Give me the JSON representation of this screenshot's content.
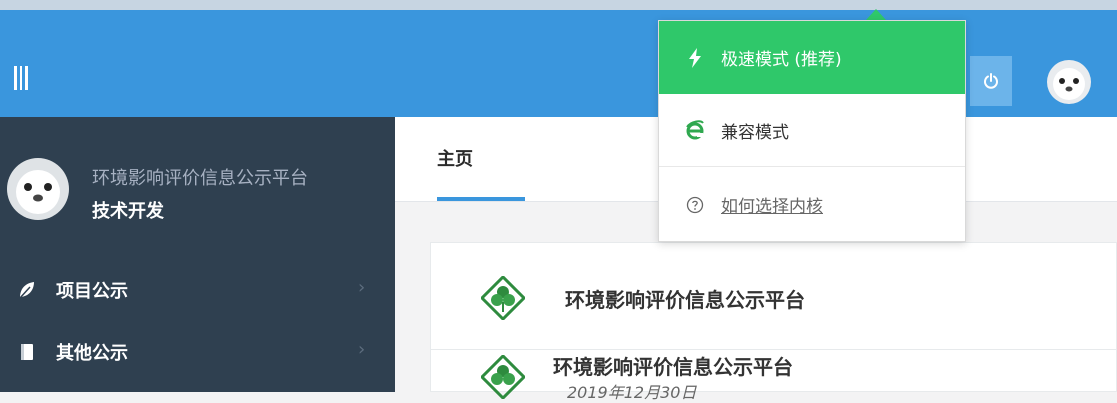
{
  "header": {
    "menu_icon": "menu-bars-icon",
    "power_icon": "power-icon",
    "avatar_icon": "seal-avatar-icon"
  },
  "user": {
    "name": "环境影响评价信息公示平台",
    "role": "技术开发"
  },
  "sidebar": {
    "items": [
      {
        "label": "项目公示",
        "icon": "leaf-icon",
        "chevron": "›"
      },
      {
        "label": "其他公示",
        "icon": "book-icon",
        "chevron": "›"
      }
    ]
  },
  "tabs": [
    {
      "label": "主页",
      "active": true
    }
  ],
  "panel": {
    "title": "环境影响评价信息公示平台",
    "items": [
      {
        "title": "环境影响评价信息公示平台",
        "date": "2019年12月30日"
      }
    ]
  },
  "dropdown": {
    "items": [
      {
        "label": "极速模式 (推荐)",
        "icon": "lightning-icon",
        "selected": true
      },
      {
        "label": "兼容模式",
        "icon": "ie-icon",
        "selected": false
      },
      {
        "label": "如何选择内核",
        "icon": "help-circle-icon",
        "selected": false
      }
    ]
  },
  "colors": {
    "header_blue": "#3a96dd",
    "sidebar_dark": "#2f4050",
    "fast_green": "#2fc86a"
  }
}
